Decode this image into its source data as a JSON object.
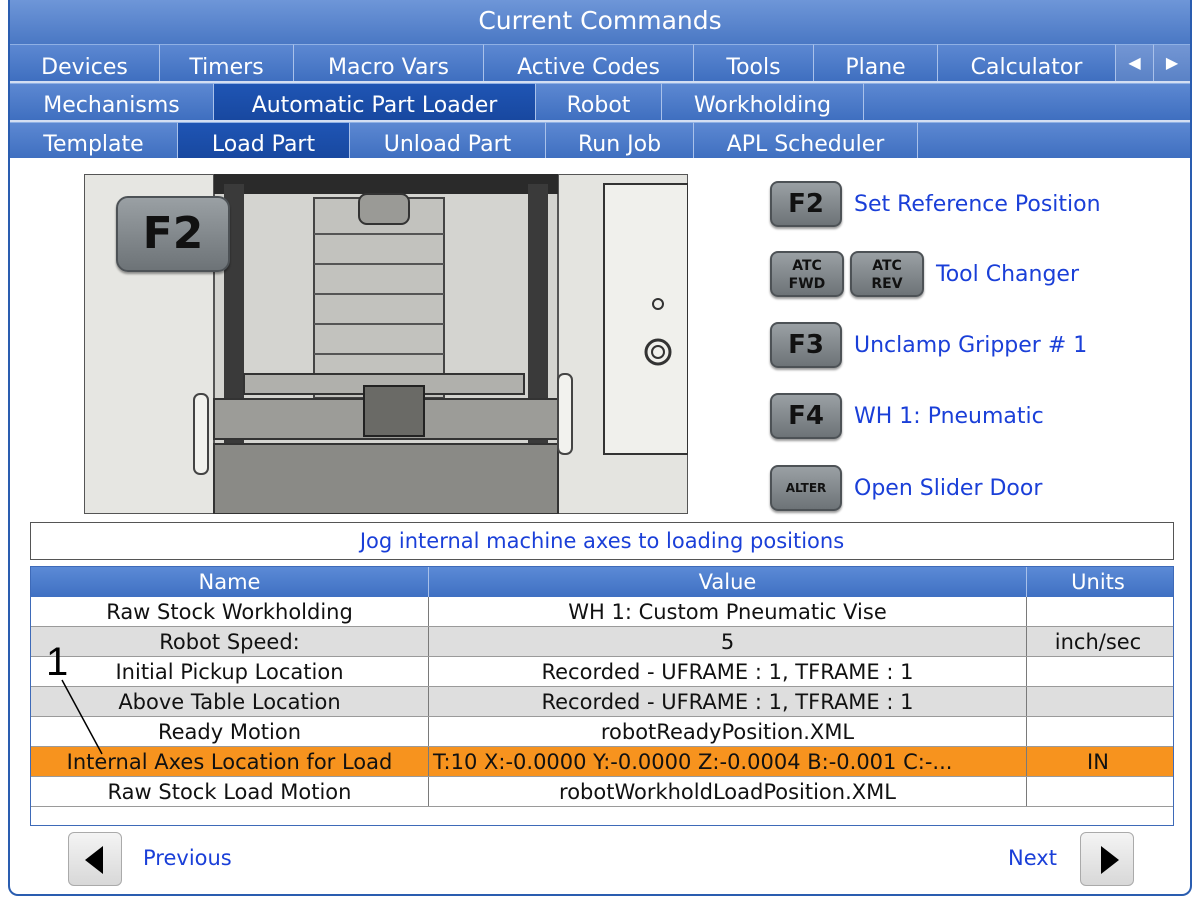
{
  "window": {
    "title": "Current Commands"
  },
  "tabs_row1": [
    {
      "label": "Devices",
      "active": false
    },
    {
      "label": "Timers",
      "active": false
    },
    {
      "label": "Macro Vars",
      "active": false
    },
    {
      "label": "Active Codes",
      "active": false
    },
    {
      "label": "Tools",
      "active": false
    },
    {
      "label": "Plane",
      "active": false
    },
    {
      "label": "Calculator",
      "active": false
    }
  ],
  "tab_scroll": {
    "left_icon": "left-arrow-icon",
    "right_icon": "right-arrow-icon"
  },
  "tabs_row2": [
    {
      "label": "Mechanisms"
    },
    {
      "label": "Automatic Part Loader"
    },
    {
      "label": "Robot"
    },
    {
      "label": "Workholding"
    }
  ],
  "tabs_row3": [
    {
      "label": "Template"
    },
    {
      "label": "Load Part"
    },
    {
      "label": "Unload Part"
    },
    {
      "label": "Run Job"
    },
    {
      "label": "APL Scheduler"
    }
  ],
  "image": {
    "key_label": "F2"
  },
  "commands": [
    {
      "keys": [
        "F2"
      ],
      "label": "Set Reference Position"
    },
    {
      "keys": [
        "ATC FWD",
        "ATC REV"
      ],
      "key_lines": [
        [
          "ATC",
          "FWD"
        ],
        [
          "ATC",
          "REV"
        ]
      ],
      "label": "Tool Changer"
    },
    {
      "keys": [
        "F3"
      ],
      "label": "Unclamp Gripper # 1"
    },
    {
      "keys": [
        "F4"
      ],
      "label": "WH 1: Pneumatic"
    },
    {
      "keys": [
        "ALTER"
      ],
      "label": "Open Slider Door"
    }
  ],
  "hint": "Jog internal machine axes to loading positions",
  "table": {
    "headers": [
      "Name",
      "Value",
      "Units"
    ],
    "rows": [
      {
        "name": "Raw Stock Workholding",
        "value": "WH 1: Custom Pneumatic Vise",
        "units": ""
      },
      {
        "name": "Robot Speed:",
        "value": "5",
        "units": "inch/sec"
      },
      {
        "name": "Initial Pickup Location",
        "value": "Recorded - UFRAME : 1, TFRAME : 1",
        "units": ""
      },
      {
        "name": "Above Table Location",
        "value": "Recorded - UFRAME : 1, TFRAME : 1",
        "units": ""
      },
      {
        "name": "Ready Motion",
        "value": "robotReadyPosition.XML",
        "units": ""
      },
      {
        "name": "Internal Axes Location for Load",
        "value": "T:10 X:-0.0000 Y:-0.0000 Z:-0.0004 B:-0.001 C:-...",
        "units": "IN"
      },
      {
        "name": "Raw Stock Load Motion",
        "value": "robotWorkholdLoadPosition.XML",
        "units": ""
      }
    ],
    "selected_row": 5
  },
  "callout": {
    "number": "1"
  },
  "nav": {
    "previous": "Previous",
    "next": "Next"
  },
  "colors": {
    "tab_blue": "#4878c8",
    "active_tab": "#1848a0",
    "link_blue": "#1a3fd8",
    "selected_row": "#f7931e"
  }
}
